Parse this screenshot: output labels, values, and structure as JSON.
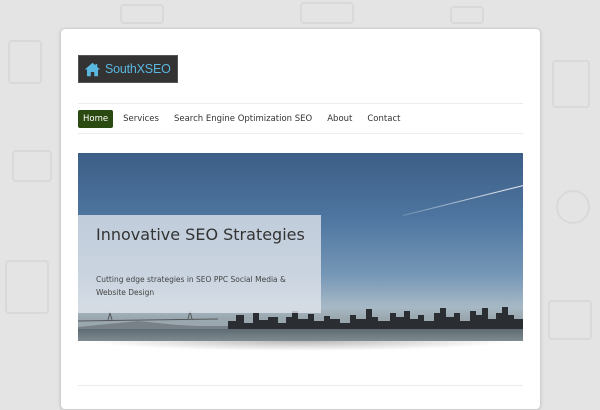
{
  "site": {
    "logo_text": "SouthXSEO"
  },
  "nav": {
    "items": [
      {
        "label": "Home",
        "active": true
      },
      {
        "label": "Services",
        "active": false
      },
      {
        "label": "Search Engine Optimization SEO",
        "active": false
      },
      {
        "label": "About",
        "active": false
      },
      {
        "label": "Contact",
        "active": false
      }
    ]
  },
  "hero": {
    "title": "Innovative SEO Strategies",
    "subtitle": "Cutting edge strategies in SEO PPC Social Media & Website Design"
  },
  "colors": {
    "accent_nav_active": "#2b4a12",
    "logo_text": "#59b7e0",
    "logo_bg": "#333333"
  },
  "icons": {
    "logo": "house-icon"
  }
}
